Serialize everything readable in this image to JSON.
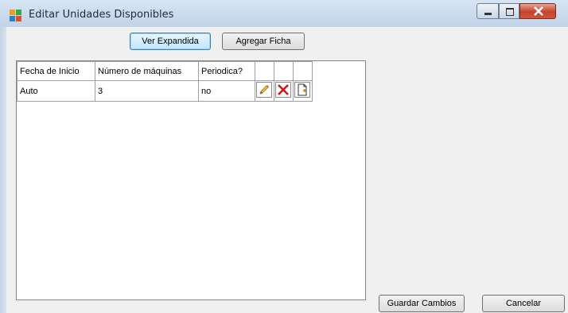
{
  "window": {
    "title": "Editar Unidades Disponibles"
  },
  "toolbar": {
    "expand_label": "Ver Expandida",
    "add_label": "Agregar Ficha"
  },
  "table": {
    "headers": [
      "Fecha de Inicio",
      "Número de máquinas",
      "Periodica?"
    ],
    "rows": [
      {
        "fecha": "Auto",
        "maquinas": "3",
        "periodica": "no"
      }
    ]
  },
  "footer": {
    "save_label": "Guardar Cambios",
    "cancel_label": "Cancelar"
  },
  "icons": {
    "app": "app-grid-icon",
    "edit": "pencil-icon",
    "delete": "red-x-icon",
    "new": "new-document-icon"
  },
  "colors": {
    "title_bar": "#c2d3e8",
    "close_button": "#c4432a",
    "focus_border": "#3c7fb1"
  }
}
